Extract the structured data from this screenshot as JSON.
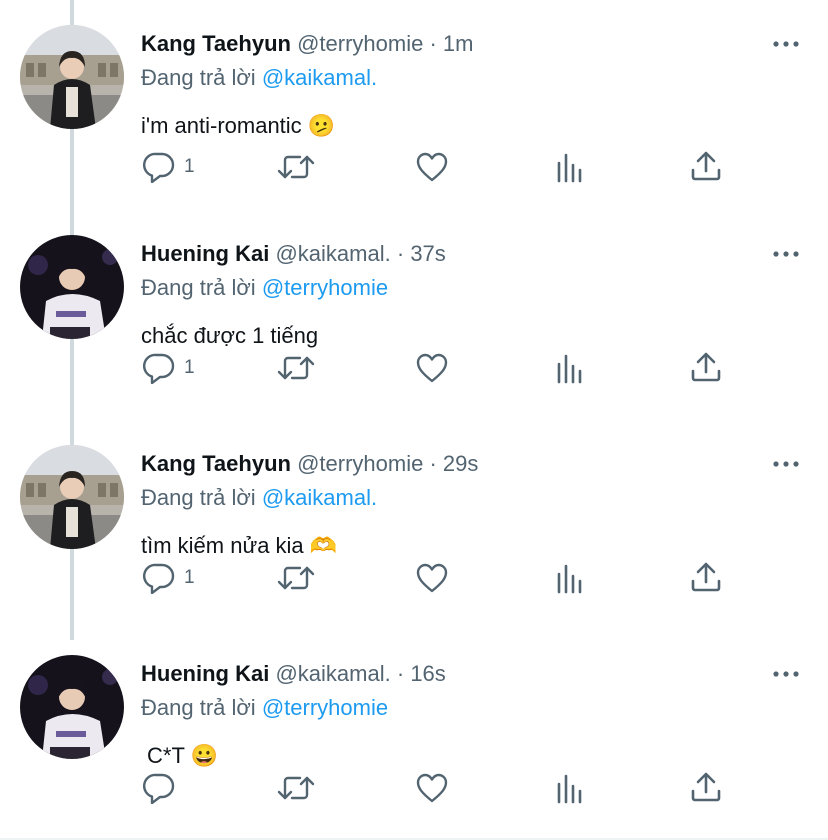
{
  "colors": {
    "accent": "#1d9bf0",
    "muted": "#536471",
    "text": "#0f1419",
    "thread_line": "#cfd9de"
  },
  "tweets": [
    {
      "display_name": "Kang Taehyun",
      "handle": "@terryhomie",
      "sep": "·",
      "time": "1m",
      "reply_prefix": "Đang trả lời",
      "reply_to": "@kaikamal.",
      "text": "i'm anti-romantic 🫤",
      "reply_count": "1",
      "avatar": "avatar-taehyun"
    },
    {
      "display_name": "Huening Kai",
      "handle": "@kaikamal.",
      "sep": "·",
      "time": "37s",
      "reply_prefix": "Đang trả lời",
      "reply_to": "@terryhomie",
      "text": "chắc được 1 tiếng",
      "reply_count": "1",
      "avatar": "avatar-kai"
    },
    {
      "display_name": "Kang Taehyun",
      "handle": "@terryhomie",
      "sep": "·",
      "time": "29s",
      "reply_prefix": "Đang trả lời",
      "reply_to": "@kaikamal.",
      "text": "tìm kiếm nửa kia 🫶",
      "reply_count": "1",
      "avatar": "avatar-taehyun"
    },
    {
      "display_name": "Huening Kai",
      "handle": "@kaikamal.",
      "sep": "·",
      "time": "16s",
      "reply_prefix": "Đang trả lời",
      "reply_to": "@terryhomie",
      "text": "C*T 😀",
      "reply_count": "",
      "avatar": "avatar-kai"
    }
  ],
  "icons": [
    "reply-icon",
    "retweet-icon",
    "like-icon",
    "views-icon",
    "share-icon",
    "more-icon"
  ]
}
